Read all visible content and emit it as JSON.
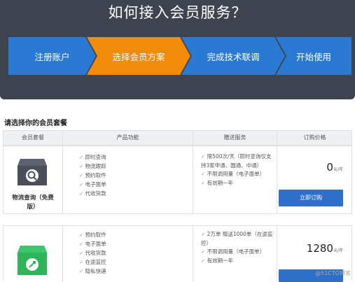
{
  "hero": {
    "title": "如何接入会员服务？",
    "steps": [
      {
        "label": "注册账户",
        "color": "#2a7ad4"
      },
      {
        "label": "选择会员方案",
        "color": "#f28a0a"
      },
      {
        "label": "完成技术联调",
        "color": "#2a7ad4"
      },
      {
        "label": "开始使用",
        "color": "#2a7ad4"
      }
    ]
  },
  "section_title": "请选择你的会员套餐",
  "table": {
    "headers": [
      "会员套餐",
      "产品功能",
      "赠送服务",
      "订购价格"
    ],
    "rows": [
      {
        "package_name": "物流查询（免费版）",
        "icon": "search-box-icon",
        "icon_color": "#4a4f5a",
        "features": [
          "即时查询",
          "物流跟踪",
          "预约取件",
          "电子面单",
          "代收货款"
        ],
        "services": [
          "限500次/天（即时查询仅支持3家申通、圆通、中通）",
          "不限调用量（电子面单）",
          "有效期一年"
        ],
        "price": "0",
        "price_unit": "元/年",
        "buy_label": "立即订购"
      },
      {
        "package_name": "",
        "icon": "rocket-box-icon",
        "icon_color": "#2fb45a",
        "features": [
          "预约取件",
          "电子面单",
          "代收货款",
          "在途监控",
          "隐私快递"
        ],
        "services": [
          "2万单  赠送1000单（在途监控）",
          "不限调用量（电子面单）",
          "有效期一年"
        ],
        "price": "1280",
        "price_unit": "元/年",
        "buy_label": ""
      }
    ]
  },
  "watermark": "@51CTO博客"
}
